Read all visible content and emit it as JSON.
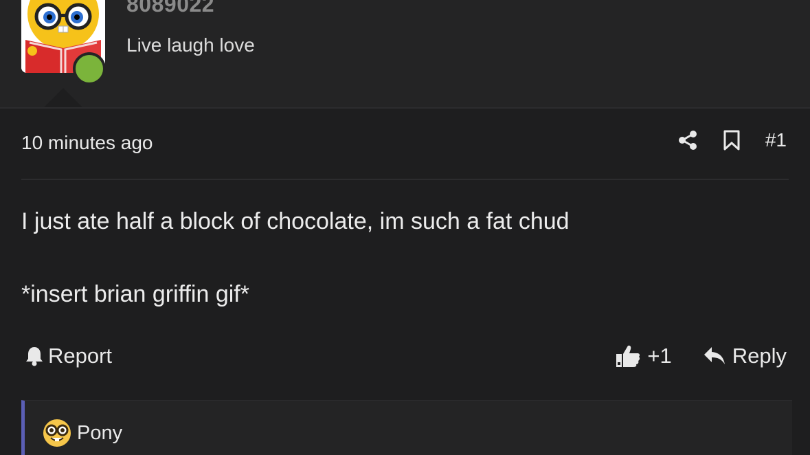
{
  "user": {
    "name": "8089022",
    "title": "Live laugh love",
    "status_color": "#7bb43b"
  },
  "post": {
    "time": "10 minutes ago",
    "number": "#1",
    "body": [
      "I just ate half a block of chocolate, im such a fat chud",
      "*insert brian griffin gif*"
    ],
    "report_label": "Report",
    "like_count": "+1",
    "reply_label": "Reply"
  },
  "quote": {
    "author": "Pony",
    "accent_color": "#5b5fb5"
  },
  "icons": {
    "share": "share-icon",
    "bookmark": "bookmark-icon",
    "report": "bell-icon",
    "like": "thumbs-up-icon",
    "reply": "reply-arrow-icon",
    "quote_avatar": "nerd-face-icon"
  }
}
